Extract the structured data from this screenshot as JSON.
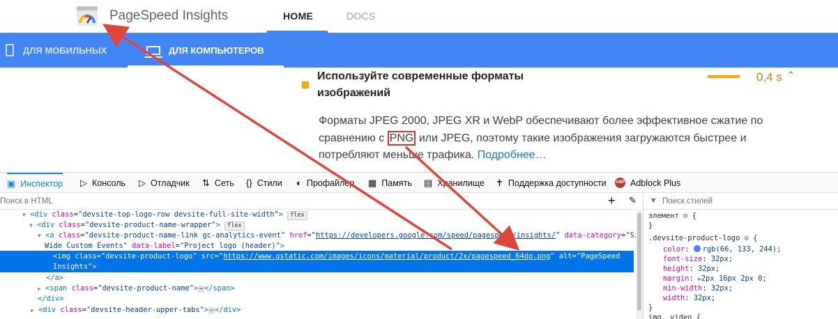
{
  "header": {
    "brand": "PageSpeed Insights",
    "nav": [
      "HOME",
      "DOCS"
    ]
  },
  "device_tabs": {
    "mobile": "ДЛЯ МОБИЛЬНЫХ",
    "desktop": "ДЛЯ КОМПЬЮТЕРОВ"
  },
  "audit": {
    "title": "Используйте современные форматы изображений",
    "time": "0,4 s",
    "desc_before": "Форматы JPEG 2000, JPEG XR и WebP обеспечивают более эффективное сжатие по сравнению с ",
    "desc_highlight": "PNG",
    "desc_after": " или JPEG, поэтому такие изображения загружаются быстрее и потребляют меньше трафика. ",
    "link": "Подробнее…",
    "colors": {
      "indicator": "#ffa400",
      "time": "#e8710a",
      "annotation": "#e0453a"
    }
  },
  "devtools": {
    "tabs": [
      "Инспектор",
      "Консоль",
      "Отладчик",
      "Сеть",
      "Стили",
      "Профайлер",
      "Память",
      "Хранилище",
      "Поддержка доступности",
      "Adblock Plus"
    ],
    "abp_badge": "ABP",
    "html_search_placeholder": "Поиск в HTML",
    "rules_search_placeholder": "Поиск стилей",
    "tree": {
      "l1": {
        "tag": "div",
        "attr": "class",
        "val": "\"devsite-top-logo-row devsite-full-site-width\"",
        "badge": "flex"
      },
      "l2": {
        "tag": "div",
        "attr": "class",
        "val": "\"devsite-product-name-wrapper\"",
        "badge": "flex"
      },
      "l3a": {
        "tag": "a",
        "attr1": "class",
        "val1": "\"devsite-product-name-link gc-analytics-event\"",
        "attr2": "href",
        "url": "https://developers.google.com/speed/pagespeed/insights/",
        "attr3": "data-category",
        "val3a": "\"Site-"
      },
      "l3b": {
        "val3b": "Wide Custom Events\"",
        "attr4": "data-label",
        "val4": "\"Project logo (header)\""
      },
      "l4a": {
        "tag": "img",
        "attr1": "class",
        "val1": "\"devsite-product-logo\"",
        "attr2": "src",
        "url": "https://www.gstatic.com/images/icons/material/product/2x/pagespeed_64dp.png",
        "attr3": "alt",
        "val3a": "\"PageSpeed"
      },
      "l4b": {
        "val3b": "Insights\""
      },
      "l5": "</a>",
      "l6": {
        "tag": "span",
        "attr": "class",
        "val": "\"devsite-product-name\"",
        "ellipsis": "⋯",
        "close": "</span>"
      },
      "l7": "</div>",
      "l8": {
        "tag": "div",
        "attr": "class",
        "val": "\"devsite-header-upper-tabs\"",
        "ellipsis": "⋯",
        "close": "</div>"
      }
    },
    "rules": {
      "element": "элемент",
      "selector": ".devsite-product-logo",
      "props": [
        {
          "name": "color",
          "value": "rgb(66, 133, 244)",
          "swatch": "#4285f4"
        },
        {
          "name": "font-size",
          "value": "32px"
        },
        {
          "name": "height",
          "value": "32px"
        },
        {
          "name": "margin",
          "value": "2px 16px 2px 0"
        },
        {
          "name": "min-width",
          "value": "32px"
        },
        {
          "name": "width",
          "value": "32px"
        }
      ],
      "next": "img, video {"
    }
  }
}
